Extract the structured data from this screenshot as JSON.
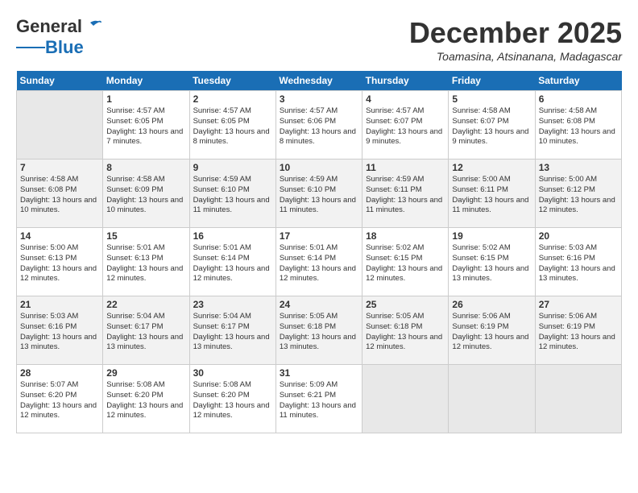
{
  "header": {
    "logo_top": "General",
    "logo_bottom": "Blue",
    "month": "December 2025",
    "location": "Toamasina, Atsinanana, Madagascar"
  },
  "weekdays": [
    "Sunday",
    "Monday",
    "Tuesday",
    "Wednesday",
    "Thursday",
    "Friday",
    "Saturday"
  ],
  "weeks": [
    [
      {
        "day": null
      },
      {
        "day": 1,
        "sunrise": "4:57 AM",
        "sunset": "6:05 PM",
        "daylight": "13 hours and 7 minutes."
      },
      {
        "day": 2,
        "sunrise": "4:57 AM",
        "sunset": "6:05 PM",
        "daylight": "13 hours and 8 minutes."
      },
      {
        "day": 3,
        "sunrise": "4:57 AM",
        "sunset": "6:06 PM",
        "daylight": "13 hours and 8 minutes."
      },
      {
        "day": 4,
        "sunrise": "4:57 AM",
        "sunset": "6:07 PM",
        "daylight": "13 hours and 9 minutes."
      },
      {
        "day": 5,
        "sunrise": "4:58 AM",
        "sunset": "6:07 PM",
        "daylight": "13 hours and 9 minutes."
      },
      {
        "day": 6,
        "sunrise": "4:58 AM",
        "sunset": "6:08 PM",
        "daylight": "13 hours and 10 minutes."
      }
    ],
    [
      {
        "day": 7,
        "sunrise": "4:58 AM",
        "sunset": "6:08 PM",
        "daylight": "13 hours and 10 minutes."
      },
      {
        "day": 8,
        "sunrise": "4:58 AM",
        "sunset": "6:09 PM",
        "daylight": "13 hours and 10 minutes."
      },
      {
        "day": 9,
        "sunrise": "4:59 AM",
        "sunset": "6:10 PM",
        "daylight": "13 hours and 11 minutes."
      },
      {
        "day": 10,
        "sunrise": "4:59 AM",
        "sunset": "6:10 PM",
        "daylight": "13 hours and 11 minutes."
      },
      {
        "day": 11,
        "sunrise": "4:59 AM",
        "sunset": "6:11 PM",
        "daylight": "13 hours and 11 minutes."
      },
      {
        "day": 12,
        "sunrise": "5:00 AM",
        "sunset": "6:11 PM",
        "daylight": "13 hours and 11 minutes."
      },
      {
        "day": 13,
        "sunrise": "5:00 AM",
        "sunset": "6:12 PM",
        "daylight": "13 hours and 12 minutes."
      }
    ],
    [
      {
        "day": 14,
        "sunrise": "5:00 AM",
        "sunset": "6:13 PM",
        "daylight": "13 hours and 12 minutes."
      },
      {
        "day": 15,
        "sunrise": "5:01 AM",
        "sunset": "6:13 PM",
        "daylight": "13 hours and 12 minutes."
      },
      {
        "day": 16,
        "sunrise": "5:01 AM",
        "sunset": "6:14 PM",
        "daylight": "13 hours and 12 minutes."
      },
      {
        "day": 17,
        "sunrise": "5:01 AM",
        "sunset": "6:14 PM",
        "daylight": "13 hours and 12 minutes."
      },
      {
        "day": 18,
        "sunrise": "5:02 AM",
        "sunset": "6:15 PM",
        "daylight": "13 hours and 12 minutes."
      },
      {
        "day": 19,
        "sunrise": "5:02 AM",
        "sunset": "6:15 PM",
        "daylight": "13 hours and 13 minutes."
      },
      {
        "day": 20,
        "sunrise": "5:03 AM",
        "sunset": "6:16 PM",
        "daylight": "13 hours and 13 minutes."
      }
    ],
    [
      {
        "day": 21,
        "sunrise": "5:03 AM",
        "sunset": "6:16 PM",
        "daylight": "13 hours and 13 minutes."
      },
      {
        "day": 22,
        "sunrise": "5:04 AM",
        "sunset": "6:17 PM",
        "daylight": "13 hours and 13 minutes."
      },
      {
        "day": 23,
        "sunrise": "5:04 AM",
        "sunset": "6:17 PM",
        "daylight": "13 hours and 13 minutes."
      },
      {
        "day": 24,
        "sunrise": "5:05 AM",
        "sunset": "6:18 PM",
        "daylight": "13 hours and 13 minutes."
      },
      {
        "day": 25,
        "sunrise": "5:05 AM",
        "sunset": "6:18 PM",
        "daylight": "13 hours and 12 minutes."
      },
      {
        "day": 26,
        "sunrise": "5:06 AM",
        "sunset": "6:19 PM",
        "daylight": "13 hours and 12 minutes."
      },
      {
        "day": 27,
        "sunrise": "5:06 AM",
        "sunset": "6:19 PM",
        "daylight": "13 hours and 12 minutes."
      }
    ],
    [
      {
        "day": 28,
        "sunrise": "5:07 AM",
        "sunset": "6:20 PM",
        "daylight": "13 hours and 12 minutes."
      },
      {
        "day": 29,
        "sunrise": "5:08 AM",
        "sunset": "6:20 PM",
        "daylight": "13 hours and 12 minutes."
      },
      {
        "day": 30,
        "sunrise": "5:08 AM",
        "sunset": "6:20 PM",
        "daylight": "13 hours and 12 minutes."
      },
      {
        "day": 31,
        "sunrise": "5:09 AM",
        "sunset": "6:21 PM",
        "daylight": "13 hours and 11 minutes."
      },
      {
        "day": null
      },
      {
        "day": null
      },
      {
        "day": null
      }
    ]
  ],
  "labels": {
    "sunrise": "Sunrise:",
    "sunset": "Sunset:",
    "daylight_prefix": "Daylight:"
  }
}
